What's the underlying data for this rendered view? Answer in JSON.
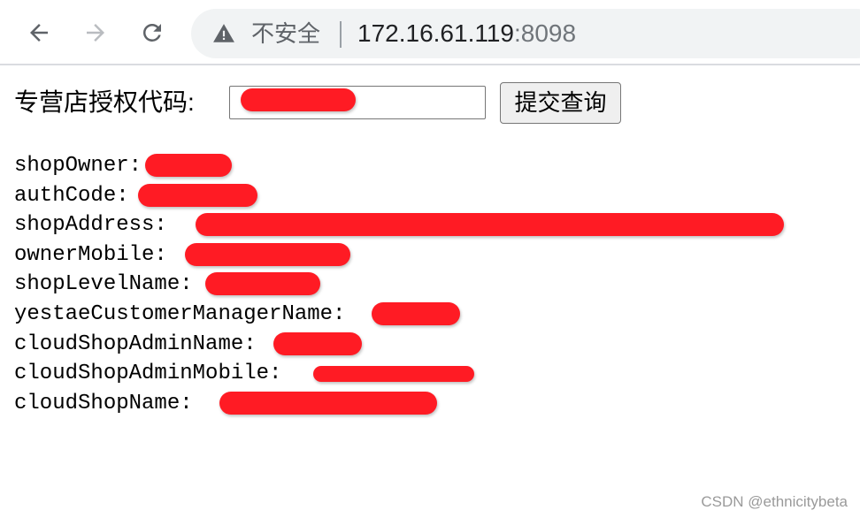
{
  "browser": {
    "back_icon": "arrow-left-icon",
    "forward_icon": "arrow-right-icon",
    "reload_icon": "reload-icon",
    "security_icon": "warning-triangle-icon",
    "security_text": "不安全",
    "url_host": "172.16.61.119",
    "url_port": ":8098"
  },
  "form": {
    "label": "专营店授权代码:",
    "input_value": "",
    "submit_label": "提交查询"
  },
  "info": {
    "shopOwner": "shopOwner:",
    "authCode": "authCode:",
    "shopAddress": "shopAddress:",
    "ownerMobile": "ownerMobile:",
    "shopLevelName": "shopLevelName:",
    "yestaeCustomerManagerName": "yestaeCustomerManagerName:",
    "cloudShopAdminName": "cloudShopAdminName:",
    "cloudShopAdminMobile": "cloudShopAdminMobile:",
    "cloudShopName": "cloudShopName:"
  },
  "redaction_color": "#ff1b24",
  "watermark": "CSDN @ethnicitybeta"
}
